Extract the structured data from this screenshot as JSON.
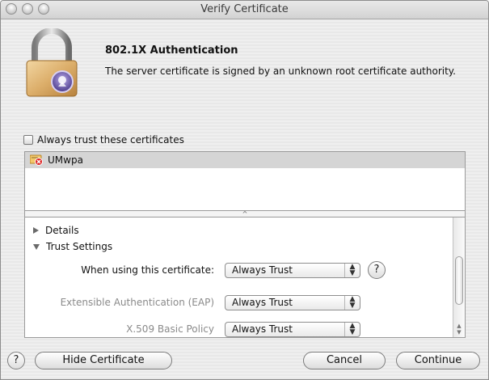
{
  "window": {
    "title": "Verify Certificate"
  },
  "header": {
    "heading": "802.1X Authentication",
    "message": "The server certificate is signed by an unknown root certificate authority."
  },
  "trust_checkbox": {
    "label": "Always trust these certificates",
    "checked": false
  },
  "certificates": [
    {
      "name": "UMwpa",
      "icon": "certificate-error-icon"
    }
  ],
  "details": {
    "sections": [
      {
        "label": "Details",
        "expanded": false
      },
      {
        "label": "Trust Settings",
        "expanded": true
      }
    ],
    "trust_rows": [
      {
        "label": "When using this certificate:",
        "value": "Always Trust",
        "dim": false
      },
      {
        "label": "Extensible Authentication (EAP)",
        "value": "Always Trust",
        "dim": true
      },
      {
        "label": "X.509 Basic Policy",
        "value": "Always Trust",
        "dim": true
      }
    ],
    "help_label": "?"
  },
  "footer": {
    "help_label": "?",
    "hide_certificate_label": "Hide Certificate",
    "cancel_label": "Cancel",
    "continue_label": "Continue"
  }
}
